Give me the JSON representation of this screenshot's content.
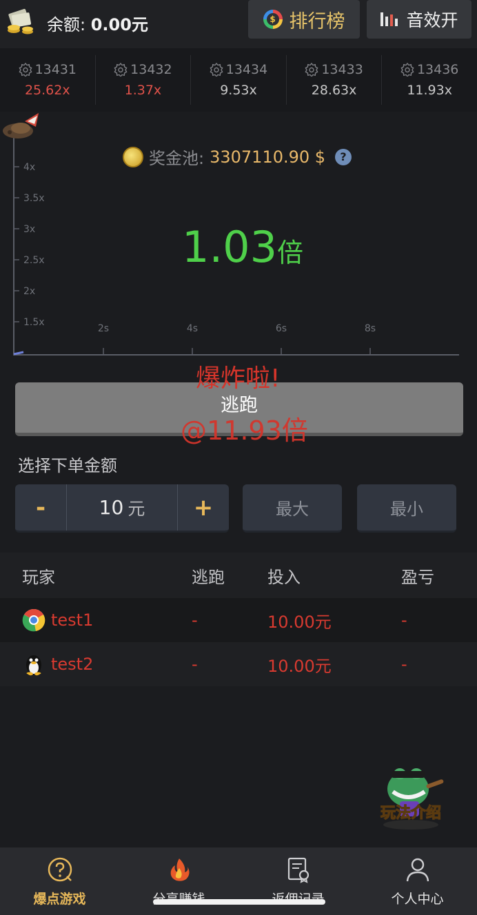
{
  "header": {
    "balance_label": "余额:",
    "balance_value": "0.00元",
    "rank_label": "排行榜",
    "sound_label": "音效开"
  },
  "history": [
    {
      "id": "13431",
      "multiplier": "25.62x",
      "color": "#e0524a"
    },
    {
      "id": "13432",
      "multiplier": "1.37x",
      "color": "#e0524a"
    },
    {
      "id": "13434",
      "multiplier": "9.53x",
      "color": "#c8c8c8"
    },
    {
      "id": "13433",
      "multiplier": "28.63x",
      "color": "#c8c8c8"
    },
    {
      "id": "13436",
      "multiplier": "11.93x",
      "color": "#c8c8c8"
    }
  ],
  "game": {
    "pool_label": "奖金池:",
    "pool_value": "3307110.90 $",
    "pool_help": "?",
    "multiplier_value": "1.03",
    "multiplier_unit": "倍",
    "y_ticks": [
      "4x",
      "3.5x",
      "3x",
      "2.5x",
      "2x",
      "1.5x"
    ],
    "x_ticks": [
      "2s",
      "4s",
      "6s",
      "8s"
    ],
    "boom_text": "爆炸啦!",
    "boom_at": "@11.93倍",
    "escape_label": "逃跑"
  },
  "bet": {
    "title": "选择下单金额",
    "minus": "-",
    "plus": "+",
    "amount": "10",
    "unit": "元",
    "max_label": "最大",
    "min_label": "最小"
  },
  "players": {
    "headers": {
      "player": "玩家",
      "escape": "逃跑",
      "bet": "投入",
      "pnl": "盈亏"
    },
    "rows": [
      {
        "name": "test1",
        "escape": "-",
        "bet": "10.00元",
        "pnl": "-"
      },
      {
        "name": "test2",
        "escape": "-",
        "bet": "10.00元",
        "pnl": "-"
      }
    ]
  },
  "mascot_text": "玩法介绍",
  "nav": [
    {
      "label": "爆点游戏",
      "icon": "question-circle-icon",
      "active": true
    },
    {
      "label": "分享赚钱",
      "icon": "flame-icon",
      "active": false
    },
    {
      "label": "返佣记录",
      "icon": "certificate-icon",
      "active": false
    },
    {
      "label": "个人中心",
      "icon": "user-icon",
      "active": false
    }
  ],
  "colors": {
    "accent": "#e7b85a",
    "multiplier": "#4fd04a",
    "boom": "#d5352b",
    "background": "#1b1c1f"
  }
}
